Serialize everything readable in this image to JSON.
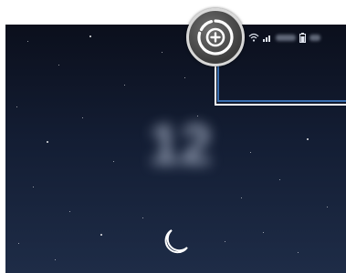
{
  "lock_screen": {
    "clock": "12",
    "status_icons": [
      "wifi-icon",
      "signal-icon",
      "battery-icon"
    ],
    "bottom_icon": "moon-icon"
  },
  "highlight": {
    "icon": "data-saver-icon",
    "colors": {
      "badge": "#4a4a4a",
      "ring": "#d8d8d8",
      "callout_outer": "#ffffff",
      "callout_inner": "#3a6fb0"
    }
  }
}
